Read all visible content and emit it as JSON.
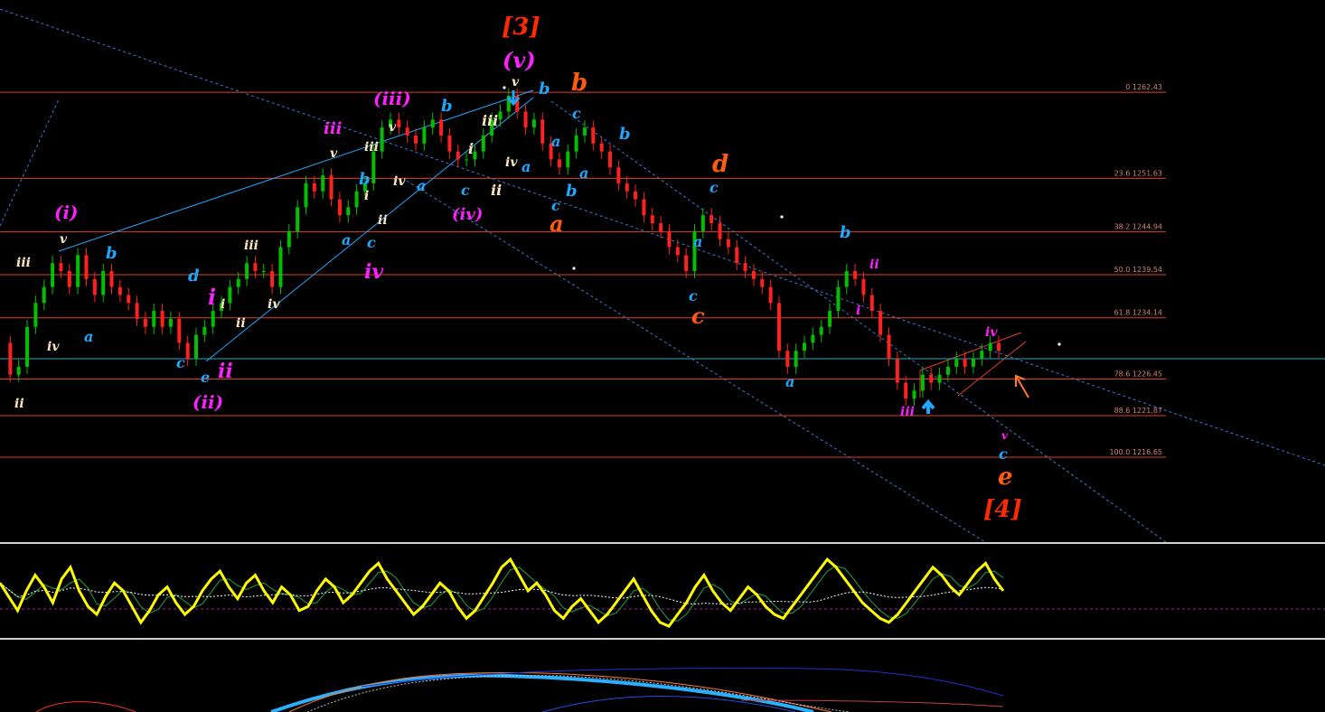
{
  "chart_data": {
    "type": "candlestick",
    "fib_levels": [
      {
        "pct": "0",
        "price": 1262.43,
        "label": "0 1262.43"
      },
      {
        "pct": "23.6",
        "price": 1251.63,
        "label": "23.6 1251.63"
      },
      {
        "pct": "38.2",
        "price": 1244.94,
        "label": "38.2 1244.94"
      },
      {
        "pct": "50.0",
        "price": 1239.54,
        "label": "50.0 1239.54"
      },
      {
        "pct": "61.8",
        "price": 1234.14,
        "label": "61.8 1234.14"
      },
      {
        "pct": "78.6",
        "price": 1226.45,
        "label": "78.6 1226.45"
      },
      {
        "pct": "88.6",
        "price": 1221.87,
        "label": "88.6 1221.87"
      },
      {
        "pct": "100.0",
        "price": 1216.65,
        "label": "100.0 1216.65"
      }
    ],
    "price_range": [
      1206,
      1274
    ],
    "current_price_line": 1229.0,
    "close_series": [
      1231,
      1227,
      1228,
      1233,
      1236,
      1238,
      1241,
      1240,
      1238,
      1242,
      1239,
      1237,
      1240,
      1238,
      1237,
      1236,
      1234,
      1233,
      1235,
      1233,
      1234,
      1231,
      1229,
      1232,
      1233,
      1235,
      1236,
      1238,
      1239,
      1241,
      1240,
      1240,
      1238,
      1243,
      1245,
      1248,
      1251,
      1250,
      1252,
      1249,
      1247,
      1248,
      1250,
      1251,
      1255,
      1258,
      1259,
      1258,
      1257,
      1256,
      1258,
      1259,
      1257,
      1255,
      1254,
      1254,
      1255,
      1257,
      1259,
      1260,
      1262,
      1260,
      1258,
      1259,
      1256,
      1254,
      1253,
      1255,
      1257,
      1258,
      1256,
      1255,
      1253,
      1251,
      1250,
      1249,
      1247,
      1246,
      1245,
      1243,
      1242,
      1240,
      1245,
      1247,
      1246,
      1244,
      1243,
      1241,
      1240,
      1239,
      1238,
      1236,
      1230,
      1228,
      1230,
      1231,
      1232,
      1233,
      1235,
      1238,
      1240,
      1239,
      1237,
      1235,
      1232,
      1229,
      1226,
      1224,
      1225,
      1227,
      1226,
      1227,
      1228,
      1229,
      1228,
      1229,
      1230,
      1231,
      1230
    ],
    "indicator_series": [
      62,
      55,
      48,
      58,
      66,
      60,
      52,
      64,
      70,
      58,
      50,
      46,
      55,
      62,
      58,
      50,
      42,
      48,
      56,
      60,
      52,
      46,
      50,
      58,
      64,
      68,
      60,
      54,
      62,
      66,
      58,
      52,
      60,
      56,
      48,
      50,
      58,
      64,
      60,
      52,
      56,
      62,
      68,
      72,
      64,
      58,
      52,
      46,
      50,
      56,
      62,
      58,
      50,
      44,
      48,
      55,
      62,
      70,
      74,
      66,
      58,
      62,
      56,
      48,
      44,
      50,
      54,
      48,
      42,
      46,
      52,
      58,
      64,
      56,
      48,
      42,
      40,
      46,
      52,
      60,
      66,
      58,
      52,
      48,
      54,
      60,
      56,
      50,
      46,
      44,
      50,
      56,
      62,
      68,
      74,
      70,
      64,
      58,
      52,
      48,
      44,
      42,
      46,
      52,
      58,
      64,
      70,
      66,
      60,
      56,
      62,
      68,
      72,
      64,
      58
    ]
  },
  "labels": {
    "deg3": "[3]",
    "deg4": "[4]",
    "minor_v": "(v)",
    "minor_i": "(i)",
    "minor_ii": "(ii)",
    "minor_iii": "(iii)",
    "minor_iv": "(iv)"
  },
  "colors": {
    "background": "#000000",
    "bull": "#00c000",
    "bear": "#ff2020",
    "fib": "#e04020",
    "channel": "#3a78d8",
    "indicator": "#ffff00",
    "wave_red": "#ff2a00",
    "wave_orange": "#ff5a10",
    "wave_magenta": "#ff20ff",
    "wave_blue": "#20a8ff",
    "wave_cream": "#ffe8c0"
  }
}
